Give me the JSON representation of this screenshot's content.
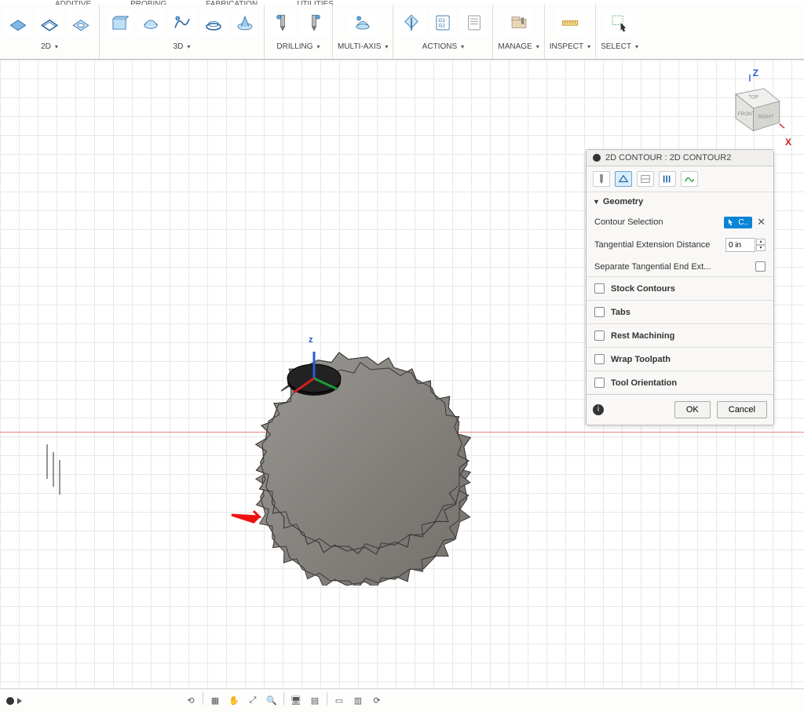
{
  "top_tabs": {
    "t1": "",
    "t2": "ADDITIVE",
    "t3": "PROBING",
    "t4": "FABRICATION",
    "t5": "UTILITIES"
  },
  "ribbon": {
    "g2d": "2D",
    "g3d": "3D",
    "drilling": "DRILLING",
    "multiaxis": "MULTI-AXIS",
    "actions": "ACTIONS",
    "manage": "MANAGE",
    "inspect": "INSPECT",
    "select": "SELECT"
  },
  "viewcube": {
    "top": "TOP",
    "front": "FRONT",
    "right": "RIGHT",
    "z": "Z",
    "x": "X"
  },
  "dialog": {
    "title": "2D CONTOUR : 2D CONTOUR2",
    "section_geometry": "Geometry",
    "row_contour_sel": "Contour Selection",
    "chip_label": "C..",
    "row_tang_ext": "Tangential Extension Distance",
    "tang_ext_val": "0 in",
    "row_sep_tang": "Separate Tangential End Ext...",
    "stock_contours": "Stock Contours",
    "tabs": "Tabs",
    "rest_machining": "Rest Machining",
    "wrap_toolpath": "Wrap Toolpath",
    "tool_orientation": "Tool Orientation",
    "ok": "OK",
    "cancel": "Cancel"
  },
  "triad": {
    "z": "z"
  }
}
